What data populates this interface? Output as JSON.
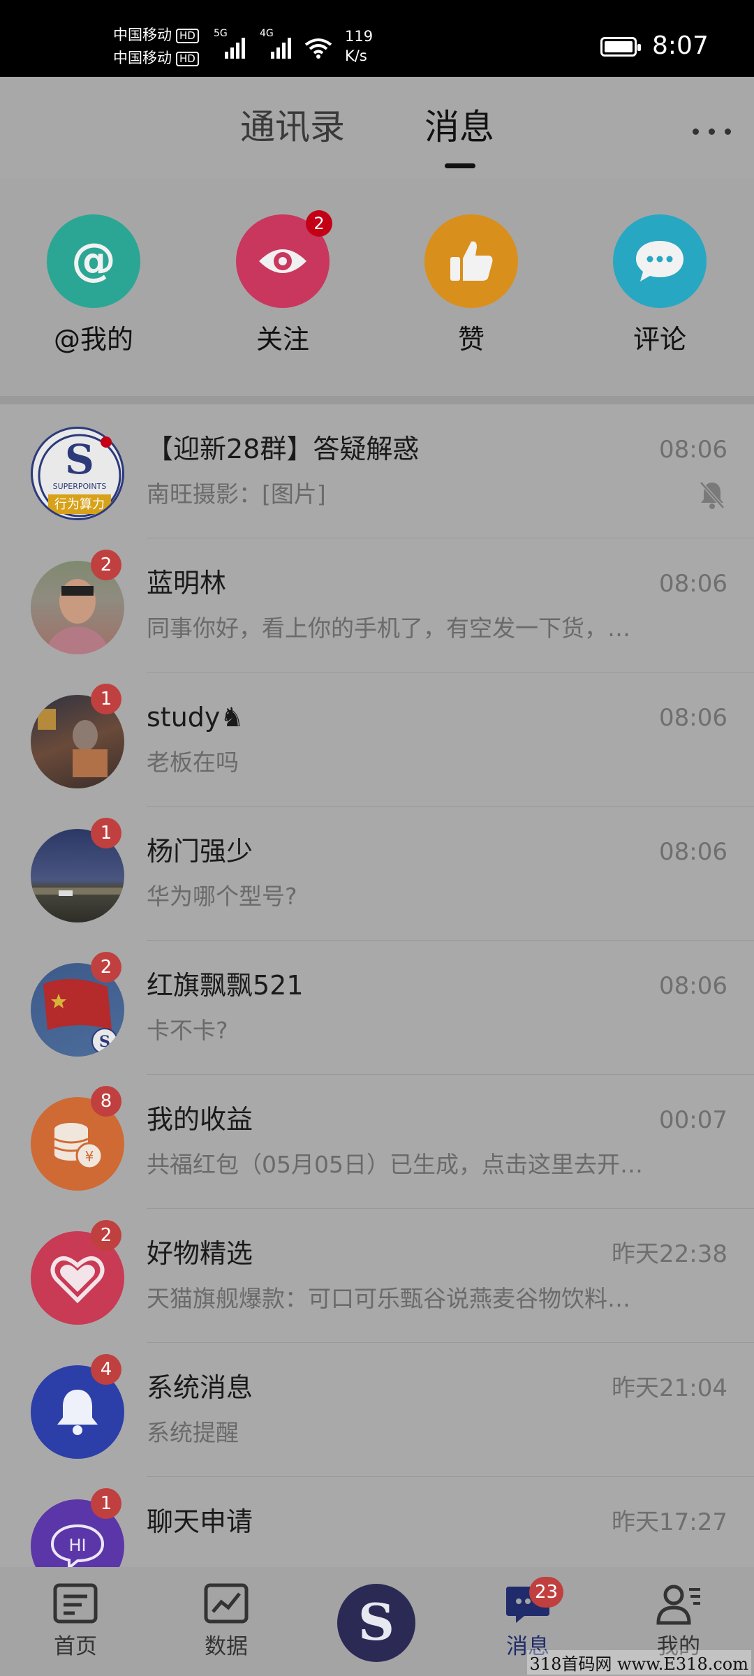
{
  "status_bar": {
    "carrier1": "中国移动",
    "carrier2": "中国移动",
    "hd": "HD",
    "net1": "5G",
    "net2": "4G",
    "speed_value": "119",
    "speed_unit": "K/s",
    "time": "8:07"
  },
  "header": {
    "tabs": [
      {
        "label": "通讯录"
      },
      {
        "label": "消息"
      }
    ],
    "active_tab": "消息"
  },
  "shortcuts": [
    {
      "label": "@我的",
      "icon": "at-icon",
      "color": "#2bb39b"
    },
    {
      "label": "关注",
      "icon": "eye-icon",
      "color": "#d9365f",
      "badge": "2"
    },
    {
      "label": "赞",
      "icon": "thumbs-up-icon",
      "color": "#e59a1e"
    },
    {
      "label": "评论",
      "icon": "comment-icon",
      "color": "#2ab3cf"
    }
  ],
  "conversations": [
    {
      "title": "【迎新28群】答疑解惑",
      "time": "08:06",
      "preview": "南旺摄影：[图片]",
      "muted": true,
      "avatar_text_top": "S",
      "avatar_text_mid": "SUPERPOINTS",
      "avatar_text_bottom": "行为算力"
    },
    {
      "title": "蓝明林",
      "time": "08:06",
      "preview": "同事你好，看上你的手机了，有空发一下货，…",
      "badge": "2"
    },
    {
      "title": "study♞",
      "time": "08:06",
      "preview": "老板在吗",
      "badge": "1"
    },
    {
      "title": "杨门强少",
      "time": "08:06",
      "preview": "华为哪个型号?",
      "badge": "1"
    },
    {
      "title": "红旗飘飘521",
      "time": "08:06",
      "preview": "卡不卡?",
      "badge": "2"
    },
    {
      "title": "我的收益",
      "time": "00:07",
      "preview": "共福红包（05月05日）已生成，点击这里去开…",
      "badge": "8"
    },
    {
      "title": "好物精选",
      "time": "昨天22:38",
      "preview": "天猫旗舰爆款：可口可乐甄谷说燕麦谷物饮料…",
      "badge": "2"
    },
    {
      "title": "系统消息",
      "time": "昨天21:04",
      "preview": "系统提醒",
      "badge": "4"
    },
    {
      "title": "聊天申请",
      "time": "昨天17:27",
      "preview": "",
      "badge": "1",
      "avatar_text": "HI"
    }
  ],
  "bottom_nav": {
    "items": [
      {
        "label": "首页"
      },
      {
        "label": "数据"
      },
      {
        "label": "消息",
        "badge": "23"
      },
      {
        "label": "我的"
      }
    ],
    "center_symbol": "S"
  },
  "watermark": "318首码网 www.E318.com",
  "colors": {
    "badge": "#c0403f",
    "dim_overlay": "#a9a9a9",
    "active_nav": "#1f2b6b"
  }
}
